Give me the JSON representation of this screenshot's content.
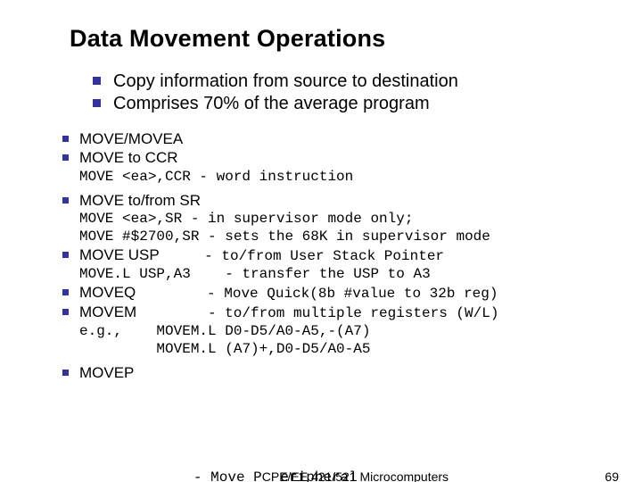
{
  "title": "Data Movement Operations",
  "top_bullets": [
    "Copy information from source to destination",
    "Comprises 70% of the average program"
  ],
  "items": {
    "movea": "MOVE/MOVEA",
    "move_to_ccr": "MOVE to CCR",
    "move_ccr_code": "MOVE <ea>,CCR - word instruction",
    "move_sr": "MOVE to/from SR",
    "move_sr_code1": "MOVE <ea>,SR - in supervisor mode only;",
    "move_sr_code2": "MOVE #$2700,SR - sets the 68K in supervisor mode",
    "move_usp": "MOVE USP",
    "move_usp_desc": "- to/from User Stack Pointer",
    "move_usp_code": "MOVE.L USP,A3",
    "move_usp_code_desc": "- transfer the USP to A3",
    "moveq": "MOVEQ",
    "moveq_desc": "- Move Quick(8b #value to 32b reg)",
    "movem": "MOVEM",
    "movem_desc": "- to/from multiple registers (W/L)",
    "movem_eg": "e.g.,",
    "movem_code1": "MOVEM.L D0-D5/A0-A5,-(A7)",
    "movem_code2": "MOVEM.L (A7)+,D0-D5/A0-A5",
    "movep": "MOVEP",
    "movep_desc_before": "- Move P",
    "movep_desc_after": "eripheral"
  },
  "footer": {
    "center": "CPE/EE 421/521 Microcomputers",
    "page": "69"
  }
}
